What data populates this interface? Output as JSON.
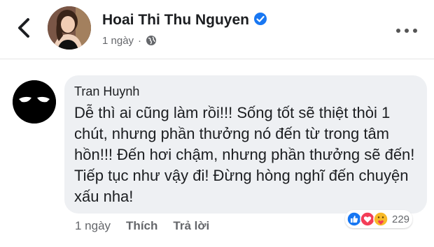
{
  "header": {
    "poster_name": "Hoai Thi Thu Nguyen",
    "time": "1 ngày",
    "separator": "·",
    "verified_color": "#1877f2"
  },
  "comment": {
    "author": "Tran Huynh",
    "text": "Dễ thì ai cũng làm rồi!!! Sống tốt sẽ thiệt thòi 1 chút, nhưng phần thưởng nó đến từ trong tâm hồn!!! Đến hơi chậm, nhưng phần thưởng sẽ đến! Tiếp tục như vậy đi! Đừng hòng nghĩ đến chuyện xấu nha!",
    "time": "1 ngày",
    "like_label": "Thích",
    "reply_label": "Trả lời",
    "reaction_count": "229",
    "reactions": [
      "like-icon",
      "love-icon",
      "care-icon"
    ]
  },
  "colors": {
    "bubble": "#eef0f3",
    "secondary_text": "#65676b",
    "like_blue": "#1877f2",
    "love_red": "#f33e58",
    "care_yellow": "#f7b928"
  }
}
